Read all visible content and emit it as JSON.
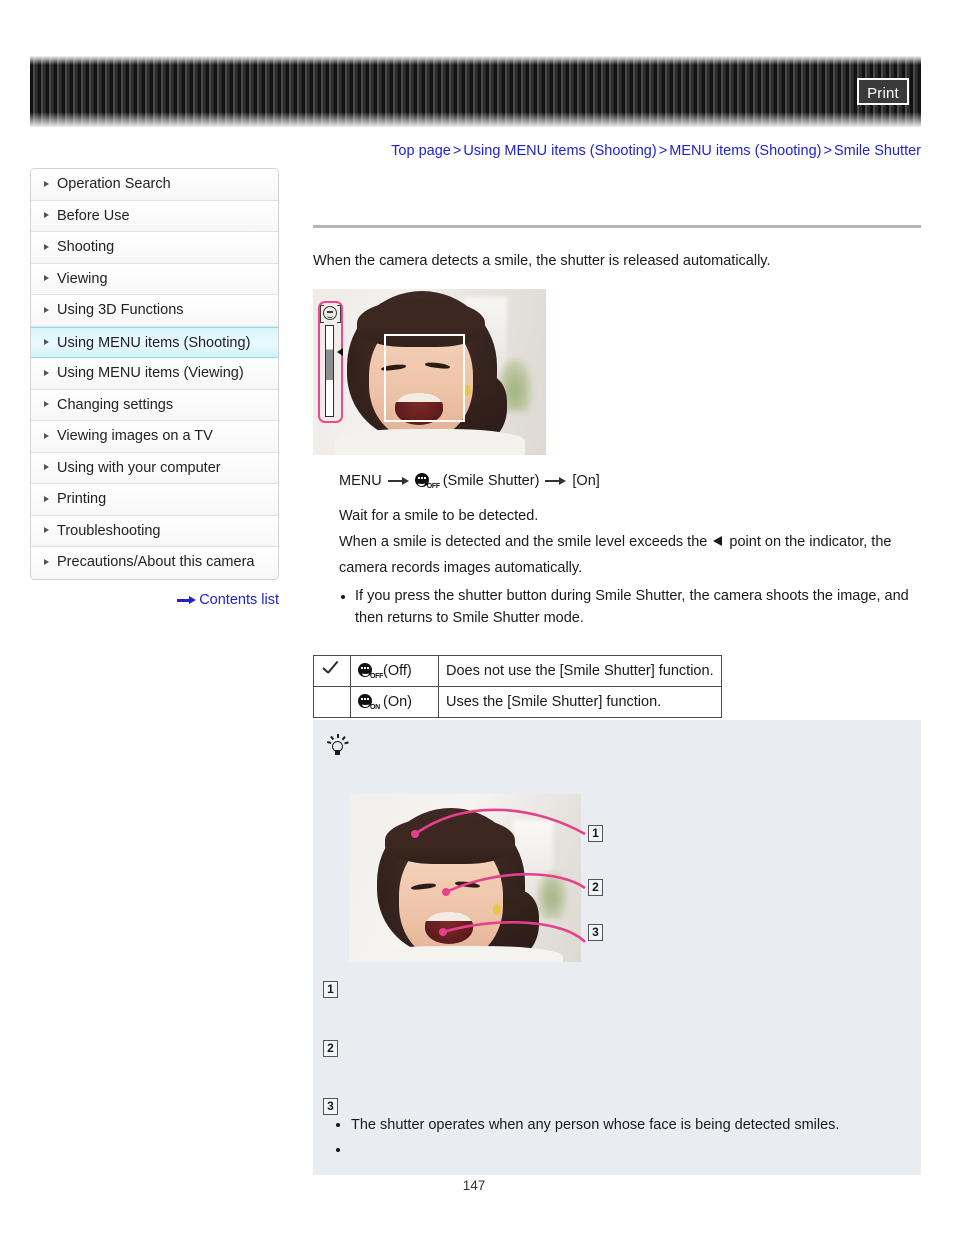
{
  "header": {
    "print_label": "Print"
  },
  "breadcrumb": {
    "items": [
      {
        "label": "Top page"
      },
      {
        "label": "Using MENU items (Shooting)"
      },
      {
        "label": "MENU items (Shooting)"
      },
      {
        "label": "Smile Shutter"
      }
    ],
    "separator": ">"
  },
  "sidebar": {
    "items": [
      {
        "label": "Operation Search",
        "active": false
      },
      {
        "label": "Before Use",
        "active": false
      },
      {
        "label": "Shooting",
        "active": false
      },
      {
        "label": "Viewing",
        "active": false
      },
      {
        "label": "Using 3D Functions",
        "active": false
      },
      {
        "label": "Using MENU items (Shooting)",
        "active": true
      },
      {
        "label": "Using MENU items (Viewing)",
        "active": false
      },
      {
        "label": "Changing settings",
        "active": false
      },
      {
        "label": "Viewing images on a TV",
        "active": false
      },
      {
        "label": "Using with your computer",
        "active": false
      },
      {
        "label": "Printing",
        "active": false
      },
      {
        "label": "Troubleshooting",
        "active": false
      },
      {
        "label": "Precautions/About this camera",
        "active": false
      }
    ],
    "contents_link": "Contents list"
  },
  "main": {
    "lead": "When the camera detects a smile, the shutter is released automatically.",
    "procedure": {
      "menu_word": "MENU",
      "icon_sub": "OFF",
      "icon_label": "(Smile Shutter)",
      "value": "[On]"
    },
    "instructions": {
      "line1": "Wait for a smile to be detected.",
      "line2_a": "When a smile is detected and the smile level exceeds the",
      "line2_b": "point on the indicator, the",
      "line3": "camera records images automatically."
    },
    "notes": [
      "If you press the shutter button during Smile Shutter, the camera shoots the image, and then returns to Smile Shutter mode."
    ],
    "options_table": {
      "rows": [
        {
          "checked": true,
          "icon_sub": "OFF",
          "mode": "(Off)",
          "description": "Does not use the [Smile Shutter] function."
        },
        {
          "checked": false,
          "icon_sub": "ON",
          "mode": "(On)",
          "description": "Uses the [Smile Shutter] function."
        }
      ]
    }
  },
  "tip": {
    "callouts": [
      {
        "number": "1",
        "label": ""
      },
      {
        "number": "2",
        "label": ""
      },
      {
        "number": "3",
        "label": ""
      }
    ],
    "legend": [
      {
        "number": "1",
        "text": ""
      },
      {
        "number": "2",
        "text": ""
      },
      {
        "number": "3",
        "text": ""
      }
    ],
    "bullets": [
      "The shutter operates when any person whose face is being detected smiles.",
      ""
    ]
  },
  "footer": {
    "page_number": "147"
  },
  "colors": {
    "link": "#2222cc",
    "accent_pink": "#f0468f",
    "active_nav": "#d8f5fb",
    "tip_bg": "#e9edf2"
  }
}
